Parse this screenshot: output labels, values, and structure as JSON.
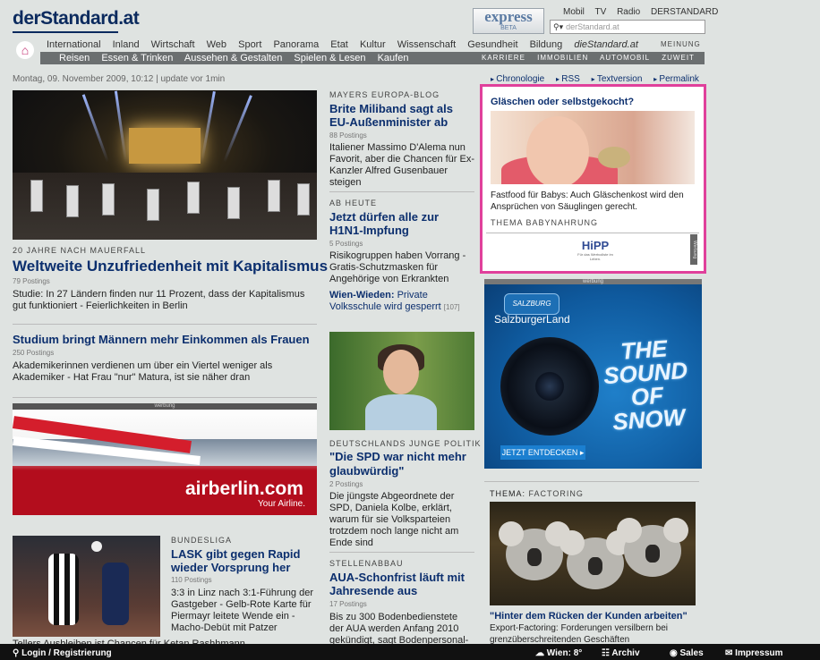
{
  "header": {
    "logo": "derStandard.at",
    "express_title": "express",
    "express_badge": "BETA",
    "top_links": [
      "Mobil",
      "TV",
      "Radio",
      "DERSTANDARD"
    ],
    "search_placeholder": "derStandard.at"
  },
  "nav": {
    "primary": [
      "International",
      "Inland",
      "Wirtschaft",
      "Web",
      "Sport",
      "Panorama",
      "Etat",
      "Kultur",
      "Wissenschaft",
      "Gesundheit",
      "Bildung",
      "dieStandard.at"
    ],
    "primary_right": "MEINUNG",
    "secondary": [
      "Reisen",
      "Essen & Trinken",
      "Aussehen & Gestalten",
      "Spielen & Lesen",
      "Kaufen"
    ],
    "secondary_right": [
      "KARRIERE",
      "IMMOBILIEN",
      "AUTOMOBIL",
      "ZUWEIT"
    ]
  },
  "date_line": "Montag, 09. November 2009, 10:12 | update vor 1min",
  "right_links": [
    "Chronologie",
    "RSS",
    "Textversion",
    "Permalink"
  ],
  "col1": {
    "lead": {
      "kicker": "20 JAHRE NACH MAUERFALL",
      "headline": "Weltweite Unzufriedenheit mit Kapitalismus",
      "postings": "79 Postings",
      "teaser": "Studie: In 27 Ländern finden nur 11 Prozent, dass der Kapitalismus gut funktioniert - Feierlichkeiten in Berlin"
    },
    "story2": {
      "headline": "Studium bringt Männern mehr Einkommen als Frauen",
      "postings": "250 Postings",
      "teaser": "Akademikerinnen verdienen um über ein Viertel weniger als Akademiker - Hat Frau \"nur\" Matura, ist sie näher dran"
    },
    "ad": {
      "label": "werbung",
      "brand": "airberlin.com",
      "tagline": "Your Airline."
    },
    "sport": {
      "kicker": "BUNDESLIGA",
      "headline": "LASK gibt gegen Rapid wieder Vorsprung her",
      "postings": "110 Postings",
      "teaser": "3:3 in Linz nach 3:1-Führung der Gastgeber - Gelb-Rote Karte für Piermayr leitete Wende ein - Macho-Debüt mit Patzer"
    },
    "cut_line": "Tellers Ausbleiben ist Chancen für Ketan Rashhmann"
  },
  "col2": {
    "s1": {
      "kicker": "MAYERS EUROPA-BLOG",
      "headline": "Brite Miliband sagt als EU-Außenminister ab",
      "postings": "88 Postings",
      "teaser": "Italiener Massimo D'Alema nun Favorit, aber die Chancen für Ex-Kanzler Alfred Gusenbauer steigen"
    },
    "s2": {
      "kicker": "AB HEUTE",
      "headline": "Jetzt dürfen alle zur H1N1-Impfung",
      "postings": "5 Postings",
      "teaser": "Risikogruppen haben Vorrang - Gratis-Schutzmasken für Angehörige von Erkrankten"
    },
    "link": {
      "bold": "Wien-Wieden:",
      "text": " Private Volksschule wird gesperrt",
      "count": "[107]"
    },
    "s3": {
      "kicker": "DEUTSCHLANDS JUNGE POLITIK",
      "headline": "\"Die SPD war nicht mehr glaubwürdig\"",
      "postings": "2 Postings",
      "teaser": "Die jüngste Abgeordnete der SPD, Daniela Kolbe, erklärt, warum für sie Volksparteien trotzdem noch lange nicht am Ende sind"
    },
    "s4": {
      "kicker": "STELLENABBAU",
      "headline": "AUA-Schonfrist läuft mit Jahresende aus",
      "postings": "17 Postings",
      "teaser": "Bis zu 300 Bodenbedienstete der AUA werden Anfang 2010 gekündigt, sagt Bodenpersonal-"
    }
  },
  "col3": {
    "promo": {
      "title": "Gläschen oder selbstgekocht?",
      "text": "Fastfood für Babys: Auch Gläschenkost wird den Ansprüchen von Säuglingen gerecht.",
      "kicker": "THEMA BABYNAHRUNG",
      "hipp": "HiPP",
      "hipp_sub": "Für das Wertvollste im Leben.",
      "side": "Werbung"
    },
    "ad": {
      "label": "werbung",
      "logo": "SALZBURG",
      "land": "SalzburgerLand",
      "slogan": "THE SOUND OF SNOW",
      "button": "JETZT ENTDECKEN ▸"
    },
    "thema": {
      "kicker_prefix": "THEMA:",
      "kicker": " FACTORING",
      "headline": "\"Hinter dem Rücken der Kunden arbeiten\"",
      "teaser": "Export-Factoring: Forderungen versilbern bei grenzüberschreitenden Geschäften"
    }
  },
  "footer": {
    "login": "Login / Registrierung",
    "weather": "Wien: 8°",
    "archiv": "Archiv",
    "sales": "Sales",
    "impressum": "Impressum"
  },
  "colors": {
    "brand": "#0b2a5e",
    "promo_border": "#e0409b",
    "nav_bar": "#6b6f70"
  }
}
